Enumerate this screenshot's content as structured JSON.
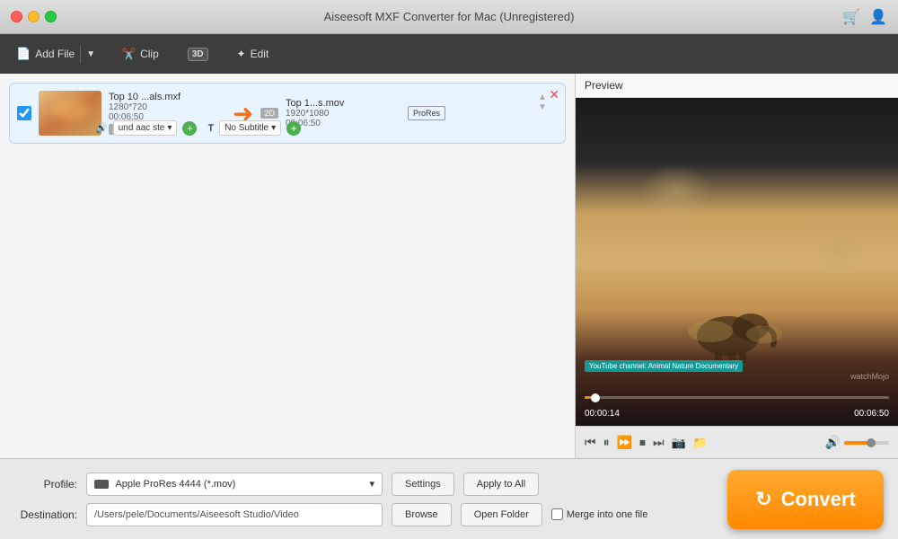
{
  "app": {
    "title": "Aiseesoft MXF Converter for Mac (Unregistered)"
  },
  "toolbar": {
    "add_file": "Add File",
    "clip": "Clip",
    "threed": "3D",
    "edit": "Edit"
  },
  "file_item": {
    "source_name": "Top 10 ...als.mxf",
    "source_res": "1280*720",
    "source_dur": "00:06:50",
    "source_badge": "2D",
    "dest_name": "Top 1...s.mov",
    "dest_res": "1920*1080",
    "dest_dur": "00:06:50",
    "dest_badge": "2D",
    "codec_badge": "ProRes",
    "audio_label": "und aac ste",
    "subtitle_label": "No Subtitle"
  },
  "preview": {
    "header": "Preview",
    "overlay_text": "YouTube channel: Animal Nature Documentary",
    "watermark": "watchMojo",
    "time_current": "00:00:14",
    "time_total": "00:06:50",
    "progress_pct": 3.5,
    "volume_pct": 70
  },
  "bottom": {
    "profile_label": "Profile:",
    "profile_value": "Apple ProRes 4444 (*.mov)",
    "settings_label": "Settings",
    "apply_all_label": "Apply to All",
    "destination_label": "Destination:",
    "destination_value": "/Users/pele/Documents/Aiseesoft Studio/Video",
    "browse_label": "Browse",
    "open_folder_label": "Open Folder",
    "merge_label": "Merge into one file"
  },
  "convert": {
    "label": "Convert"
  }
}
